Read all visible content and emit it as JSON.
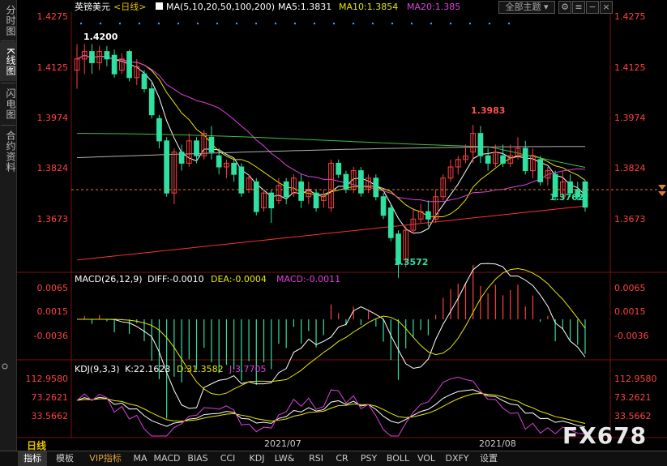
{
  "sidebar": {
    "tabs": [
      {
        "label": "分时图",
        "active": false
      },
      {
        "label": "K线图",
        "active": true
      },
      {
        "label": "闪电图",
        "active": false
      },
      {
        "label": "合约资料",
        "active": false
      }
    ]
  },
  "header": {
    "symbol": "英镑美元",
    "period": "<日线>",
    "ma_label": "MA(5,10,20,50,100,200)",
    "ma5": "MA5:1.3831",
    "ma10": "MA10:1.3854",
    "ma20": "MA20:1.385",
    "theme_button": "全部主题",
    "colors": {
      "ma5": "#ffffff",
      "ma10": "#e8e800",
      "ma20": "#e040e0",
      "ma50": "#40c040",
      "ma100": "#b0b0b0",
      "ma200": "#ff3030",
      "up": "#ff4040",
      "down": "#30e0a0"
    }
  },
  "macd_header": {
    "label": "MACD(26,12,9)",
    "diff": "DIFF:-0.0010",
    "dea": "DEA:-0.0004",
    "macd": "MACD:-0.0011"
  },
  "kdj_header": {
    "label": "KDJ(9,3,3)",
    "k": "K:22.1623",
    "d": "D:31.3582",
    "j": "J:3.7705"
  },
  "axes": {
    "main_ticks": [
      "1.4275",
      "1.4125",
      "1.3974",
      "1.3824",
      "1.3673"
    ],
    "macd_ticks": [
      "0.0065",
      "0.0015",
      "-0.0036"
    ],
    "kdj_ticks": [
      "112.9580",
      "73.2621",
      "33.5662"
    ],
    "dates": [
      "2021/07",
      "2021/08"
    ]
  },
  "annotations": {
    "high1": "1.4200",
    "high2": "1.3983",
    "low1": "1.3572",
    "last": "1.3762"
  },
  "footer": {
    "period_label": "日线",
    "watermark": "FX678",
    "buttons": [
      "指标",
      "模板",
      "VIP指标",
      "MA",
      "MACD",
      "BIAS",
      "CCI",
      "KDJ",
      "LW&",
      "RSI",
      "CR",
      "PSY",
      "BOLL",
      "VOL",
      "DXFY",
      "设置"
    ]
  },
  "chart_data": {
    "type": "candlestick",
    "title": "英镑美元 <日线>",
    "yrange": [
      1.36,
      1.4275
    ],
    "candles": [
      [
        1.413,
        1.416,
        1.408,
        1.42
      ],
      [
        1.416,
        1.418,
        1.412,
        1.42
      ],
      [
        1.418,
        1.415,
        1.412,
        1.42
      ],
      [
        1.415,
        1.418,
        1.413,
        1.4195
      ],
      [
        1.418,
        1.416,
        1.414,
        1.4195
      ],
      [
        1.417,
        1.412,
        1.411,
        1.4185
      ],
      [
        1.413,
        1.416,
        1.412,
        1.4175
      ],
      [
        1.418,
        1.411,
        1.41,
        1.4185
      ],
      [
        1.411,
        1.414,
        1.409,
        1.416
      ],
      [
        1.412,
        1.408,
        1.407,
        1.413
      ],
      [
        1.408,
        1.401,
        1.4,
        1.41
      ],
      [
        1.4,
        1.394,
        1.392,
        1.401
      ],
      [
        1.394,
        1.38,
        1.379,
        1.395
      ],
      [
        1.38,
        1.391,
        1.377,
        1.392
      ],
      [
        1.391,
        1.388,
        1.386,
        1.393
      ],
      [
        1.388,
        1.394,
        1.387,
        1.396
      ],
      [
        1.394,
        1.39,
        1.388,
        1.395
      ],
      [
        1.39,
        1.396,
        1.389,
        1.397
      ],
      [
        1.395,
        1.391,
        1.389,
        1.398
      ],
      [
        1.39,
        1.387,
        1.385,
        1.392
      ],
      [
        1.387,
        1.388,
        1.384,
        1.389
      ],
      [
        1.388,
        1.385,
        1.383,
        1.389
      ],
      [
        1.387,
        1.38,
        1.379,
        1.388
      ],
      [
        1.381,
        1.384,
        1.38,
        1.385
      ],
      [
        1.383,
        1.375,
        1.374,
        1.384
      ],
      [
        1.376,
        1.38,
        1.375,
        1.381
      ],
      [
        1.38,
        1.376,
        1.372,
        1.381
      ],
      [
        1.378,
        1.382,
        1.377,
        1.384
      ],
      [
        1.383,
        1.379,
        1.377,
        1.384
      ],
      [
        1.38,
        1.384,
        1.379,
        1.385
      ],
      [
        1.383,
        1.378,
        1.376,
        1.385
      ],
      [
        1.379,
        1.381,
        1.377,
        1.383
      ],
      [
        1.38,
        1.376,
        1.375,
        1.381
      ],
      [
        1.378,
        1.379,
        1.376,
        1.381
      ],
      [
        1.376,
        1.388,
        1.375,
        1.389
      ],
      [
        1.388,
        1.385,
        1.384,
        1.389
      ],
      [
        1.385,
        1.381,
        1.38,
        1.386
      ],
      [
        1.381,
        1.386,
        1.38,
        1.387
      ],
      [
        1.386,
        1.38,
        1.379,
        1.387
      ],
      [
        1.381,
        1.384,
        1.38,
        1.385
      ],
      [
        1.384,
        1.379,
        1.378,
        1.385
      ],
      [
        1.379,
        1.374,
        1.373,
        1.38
      ],
      [
        1.376,
        1.368,
        1.367,
        1.377
      ],
      [
        1.369,
        1.361,
        1.3572,
        1.37
      ],
      [
        1.362,
        1.37,
        1.36,
        1.371
      ],
      [
        1.37,
        1.373,
        1.369,
        1.376
      ],
      [
        1.373,
        1.375,
        1.372,
        1.377
      ],
      [
        1.375,
        1.373,
        1.371,
        1.378
      ],
      [
        1.373,
        1.379,
        1.372,
        1.381
      ],
      [
        1.379,
        1.384,
        1.378,
        1.385
      ],
      [
        1.384,
        1.387,
        1.383,
        1.389
      ],
      [
        1.387,
        1.389,
        1.385,
        1.39
      ],
      [
        1.389,
        1.39,
        1.388,
        1.393
      ],
      [
        1.391,
        1.396,
        1.388,
        1.3983
      ],
      [
        1.396,
        1.39,
        1.388,
        1.398
      ],
      [
        1.39,
        1.388,
        1.386,
        1.392
      ],
      [
        1.388,
        1.391,
        1.387,
        1.393
      ],
      [
        1.39,
        1.388,
        1.387,
        1.393
      ],
      [
        1.388,
        1.39,
        1.387,
        1.393
      ],
      [
        1.39,
        1.392,
        1.389,
        1.395
      ],
      [
        1.392,
        1.386,
        1.385,
        1.394
      ],
      [
        1.386,
        1.39,
        1.384,
        1.392
      ],
      [
        1.389,
        1.383,
        1.382,
        1.39
      ],
      [
        1.384,
        1.386,
        1.382,
        1.387
      ],
      [
        1.385,
        1.379,
        1.378,
        1.386
      ],
      [
        1.379,
        1.383,
        1.378,
        1.386
      ],
      [
        1.383,
        1.38,
        1.379,
        1.385
      ],
      [
        1.381,
        1.379,
        1.378,
        1.383
      ],
      [
        1.383,
        1.3762,
        1.375,
        1.3835
      ]
    ]
  }
}
